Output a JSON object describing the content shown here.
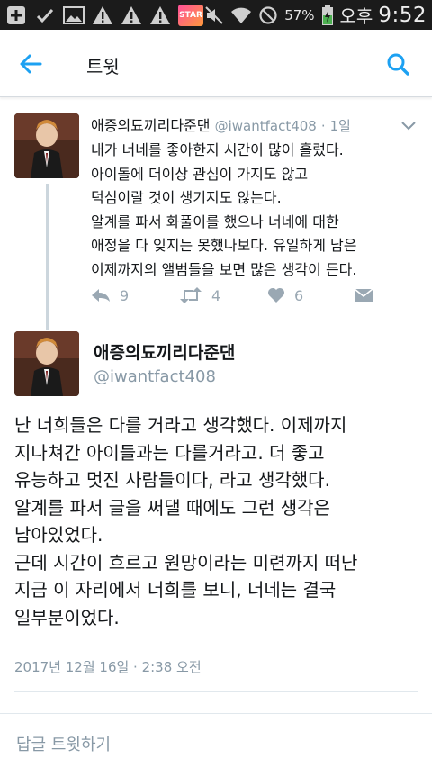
{
  "status_bar": {
    "battery_percent": "57%",
    "ampm": "오후",
    "time": "9:52",
    "notification_badge": "STAR"
  },
  "appbar": {
    "title": "트윗"
  },
  "parent_tweet": {
    "name": "애증의됴끼리다준댄",
    "handle": "@iwantfact408",
    "time": "· 1일",
    "lines": [
      "내가 너네를 좋아한지 시간이 많이 흘렀다.",
      "아이돌에 더이상 관심이 가지도 않고",
      "덕심이랄 것이 생기지도 않는다.",
      "알계를 파서 화풀이를 했으나 너네에 대한",
      "애정을 다 잊지는 못했나보다. 유일하게 남은",
      "이제까지의 앨범들을 보면 많은 생각이 든다."
    ],
    "reply_count": "9",
    "retweet_count": "4",
    "like_count": "6"
  },
  "main_tweet": {
    "name": "애증의됴끼리다준댄",
    "handle": "@iwantfact408",
    "lines": [
      "난 너희들은 다를 거라고 생각했다. 이제까지",
      "지나쳐간 아이들과는 다를거라고. 더 좋고",
      "유능하고 멋진 사람들이다, 라고 생각했다.",
      "알계를 파서 글을 써댈 때에도 그런 생각은",
      "남아있었다.",
      "근데 시간이 흐르고 원망이라는 미련까지 떠난",
      "지금 이 자리에서 너희를 보니, 너네는 결국",
      "일부분이었다."
    ],
    "timestamp": "2017년 12월 16일 · 2:38 오전"
  },
  "reply_box": {
    "placeholder": "답글 트윗하기"
  },
  "colors": {
    "accent": "#1da1f2",
    "secondary_text": "#8899a6",
    "status_bar_bg": "#1b1b1b"
  }
}
